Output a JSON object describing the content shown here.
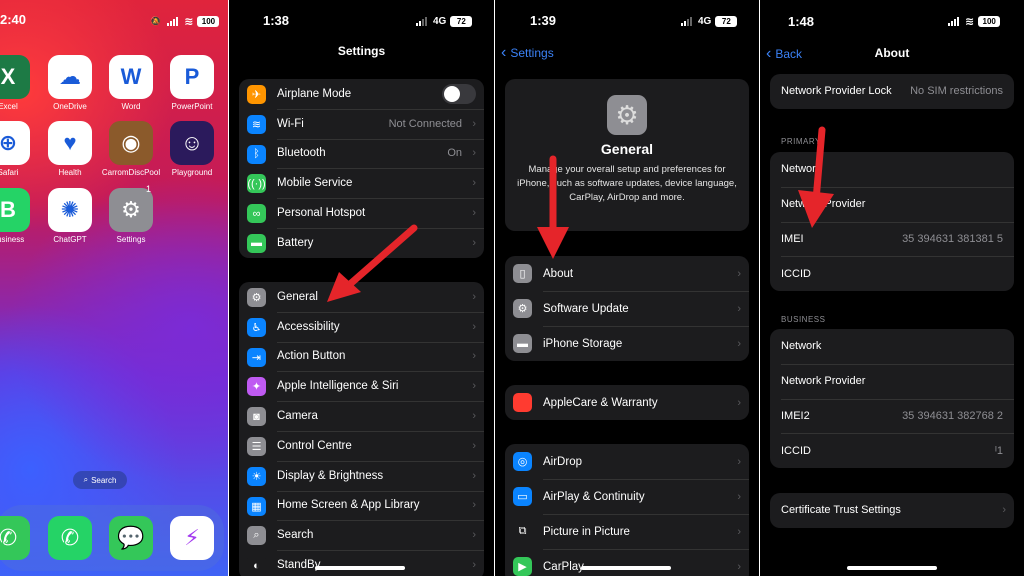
{
  "home": {
    "status": {
      "time": "2:40",
      "battery": "100"
    },
    "apps": [
      {
        "label": "Excel",
        "color": "#1d7a45",
        "glyph": "X",
        "icon": "excel-icon"
      },
      {
        "label": "OneDrive",
        "color": "#ffffff",
        "glyph": "☁",
        "icon": "onedrive-icon"
      },
      {
        "label": "Word",
        "color": "#ffffff",
        "glyph": "W",
        "icon": "word-icon"
      },
      {
        "label": "PowerPoint",
        "color": "#ffffff",
        "glyph": "P",
        "icon": "powerpoint-icon"
      },
      {
        "label": "Safari",
        "color": "#ffffff",
        "glyph": "⊕",
        "icon": "safari-icon"
      },
      {
        "label": "Health",
        "color": "#ffffff",
        "glyph": "♥",
        "icon": "health-icon"
      },
      {
        "label": "CarromDiscPool",
        "color": "#8b5a2b",
        "glyph": "◉",
        "icon": "carrom-icon"
      },
      {
        "label": "Playground",
        "color": "#2b1a5c",
        "glyph": "☺",
        "icon": "playground-icon"
      },
      {
        "label": "Business",
        "color": "#25d366",
        "glyph": "B",
        "icon": "whatsapp-business-icon"
      },
      {
        "label": "ChatGPT",
        "color": "#ffffff",
        "glyph": "✺",
        "icon": "chatgpt-icon"
      },
      {
        "label": "Settings",
        "color": "#8e8e93",
        "glyph": "⚙",
        "icon": "settings-icon"
      }
    ],
    "settings_badge": "1",
    "search_label": "Search",
    "dock": [
      {
        "glyph": "✆",
        "color": "#34c759",
        "icon": "phone-icon"
      },
      {
        "glyph": "✆",
        "color": "#25d366",
        "icon": "whatsapp-icon"
      },
      {
        "glyph": "💬",
        "color": "#34c759",
        "icon": "messages-icon"
      },
      {
        "glyph": "⚡",
        "color": "#ffffff",
        "icon": "messenger-icon"
      }
    ]
  },
  "settings": {
    "status": {
      "time": "1:38",
      "network": "4G",
      "battery": "72"
    },
    "title": "Settings",
    "group1": [
      {
        "label": "Airplane Mode",
        "value": "",
        "color": "#ff9500",
        "glyph": "✈",
        "icon": "airplane-icon",
        "toggle": true
      },
      {
        "label": "Wi-Fi",
        "value": "Not Connected",
        "color": "#0a84ff",
        "glyph": "≋",
        "icon": "wifi-icon"
      },
      {
        "label": "Bluetooth",
        "value": "On",
        "color": "#0a84ff",
        "glyph": "ᛒ",
        "icon": "bluetooth-icon"
      },
      {
        "label": "Mobile Service",
        "value": "",
        "color": "#34c759",
        "glyph": "((·))",
        "icon": "antenna-icon"
      },
      {
        "label": "Personal Hotspot",
        "value": "",
        "color": "#34c759",
        "glyph": "∞",
        "icon": "hotspot-icon"
      },
      {
        "label": "Battery",
        "value": "",
        "color": "#34c759",
        "glyph": "▬",
        "icon": "battery-icon"
      }
    ],
    "group2": [
      {
        "label": "General",
        "color": "#8e8e93",
        "glyph": "⚙",
        "icon": "gear-icon"
      },
      {
        "label": "Accessibility",
        "color": "#0a84ff",
        "glyph": "♿",
        "icon": "accessibility-icon"
      },
      {
        "label": "Action Button",
        "color": "#0a84ff",
        "glyph": "⇥",
        "icon": "action-button-icon"
      },
      {
        "label": "Apple Intelligence & Siri",
        "color": "#bf5af2",
        "glyph": "✦",
        "icon": "siri-icon"
      },
      {
        "label": "Camera",
        "color": "#8e8e93",
        "glyph": "◙",
        "icon": "camera-icon"
      },
      {
        "label": "Control Centre",
        "color": "#8e8e93",
        "glyph": "☰",
        "icon": "control-centre-icon"
      },
      {
        "label": "Display & Brightness",
        "color": "#0a84ff",
        "glyph": "☀",
        "icon": "brightness-icon"
      },
      {
        "label": "Home Screen & App Library",
        "color": "#0a84ff",
        "glyph": "▦",
        "icon": "home-screen-icon"
      },
      {
        "label": "Search",
        "color": "#8e8e93",
        "glyph": "⌕",
        "icon": "search-icon"
      },
      {
        "label": "StandBy",
        "color": "#1c1c1e",
        "glyph": "◐",
        "icon": "standby-icon"
      }
    ]
  },
  "general": {
    "status": {
      "time": "1:39",
      "network": "4G",
      "battery": "72"
    },
    "back_label": "Settings",
    "title": "General",
    "description": "Manage your overall setup and preferences for iPhone, such as software updates, device language, CarPlay, AirDrop and more.",
    "group1": [
      {
        "label": "About",
        "color": "#8e8e93",
        "glyph": "▯",
        "icon": "phone-about-icon"
      },
      {
        "label": "Software Update",
        "color": "#8e8e93",
        "glyph": "⚙",
        "icon": "software-update-icon"
      },
      {
        "label": "iPhone Storage",
        "color": "#8e8e93",
        "glyph": "▬",
        "icon": "storage-icon"
      }
    ],
    "group2": [
      {
        "label": "AppleCare & Warranty",
        "color": "#ff3b30",
        "glyph": "",
        "icon": "apple-icon"
      }
    ],
    "group3": [
      {
        "label": "AirDrop",
        "color": "#0a84ff",
        "glyph": "◎",
        "icon": "airdrop-icon"
      },
      {
        "label": "AirPlay & Continuity",
        "color": "#0a84ff",
        "glyph": "▭",
        "icon": "airplay-icon"
      },
      {
        "label": "Picture in Picture",
        "color": "#1c1c1e",
        "glyph": "⧉",
        "icon": "pip-icon"
      },
      {
        "label": "CarPlay",
        "color": "#34c759",
        "glyph": "▶",
        "icon": "carplay-icon"
      }
    ]
  },
  "about": {
    "status": {
      "time": "1:48",
      "battery": "100"
    },
    "back_label": "Back",
    "title": "About",
    "top_row": {
      "label": "Network Provider Lock",
      "value": "No SIM restrictions"
    },
    "primary_header": "PRIMARY",
    "primary": [
      {
        "label": "Network",
        "value": ""
      },
      {
        "label": "Network Provider",
        "value": ""
      },
      {
        "label": "IMEI",
        "value": "35 394631 381381 5"
      },
      {
        "label": "ICCID",
        "value": ""
      }
    ],
    "business_header": "BUSINESS",
    "business": [
      {
        "label": "Network",
        "value": ""
      },
      {
        "label": "Network Provider",
        "value": ""
      },
      {
        "label": "IMEI2",
        "value": "35 394631 382768 2"
      },
      {
        "label": "ICCID",
        "value": "ᴵ1"
      }
    ],
    "cert_label": "Certificate Trust Settings"
  },
  "colors": {
    "accent_blue": "#3b82f6",
    "arrow_red": "#e5252a",
    "cell_bg": "#1c1c1e"
  }
}
